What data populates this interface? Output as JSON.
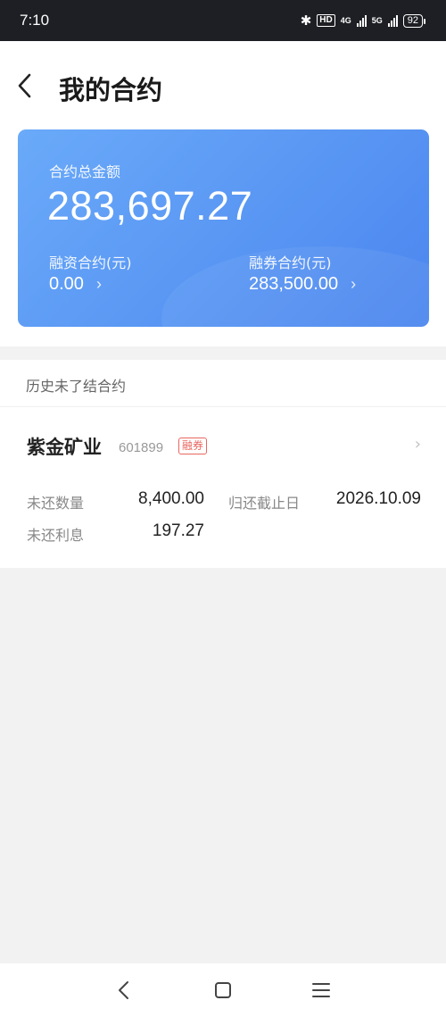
{
  "status": {
    "time": "7:10",
    "hd": "HD",
    "net1": "4G",
    "net2": "5G",
    "battery": "92"
  },
  "header": {
    "title": "我的合约"
  },
  "summary": {
    "total_label": "合约总金额",
    "total_value": "283,697.27",
    "margin_label": "融资合约(元)",
    "margin_value": "0.00",
    "short_label": "融券合约(元)",
    "short_value": "283,500.00"
  },
  "contracts": {
    "section_title": "历史未了结合约",
    "items": [
      {
        "name": "紫金矿业",
        "code": "601899",
        "tag": "融券",
        "qty_label": "未还数量",
        "qty_value": "8,400.00",
        "due_label": "归还截止日",
        "due_value": "2026.10.09",
        "interest_label": "未还利息",
        "interest_value": "197.27"
      }
    ]
  },
  "icons": {
    "back": "back-arrow-icon",
    "chevron": "chevron-right-icon",
    "nav_back": "nav-back-icon",
    "nav_home": "nav-home-icon",
    "nav_menu": "nav-menu-icon"
  },
  "colors": {
    "card_start": "#6aaaf9",
    "card_end": "#4b86ef",
    "tag": "#e8665f"
  }
}
